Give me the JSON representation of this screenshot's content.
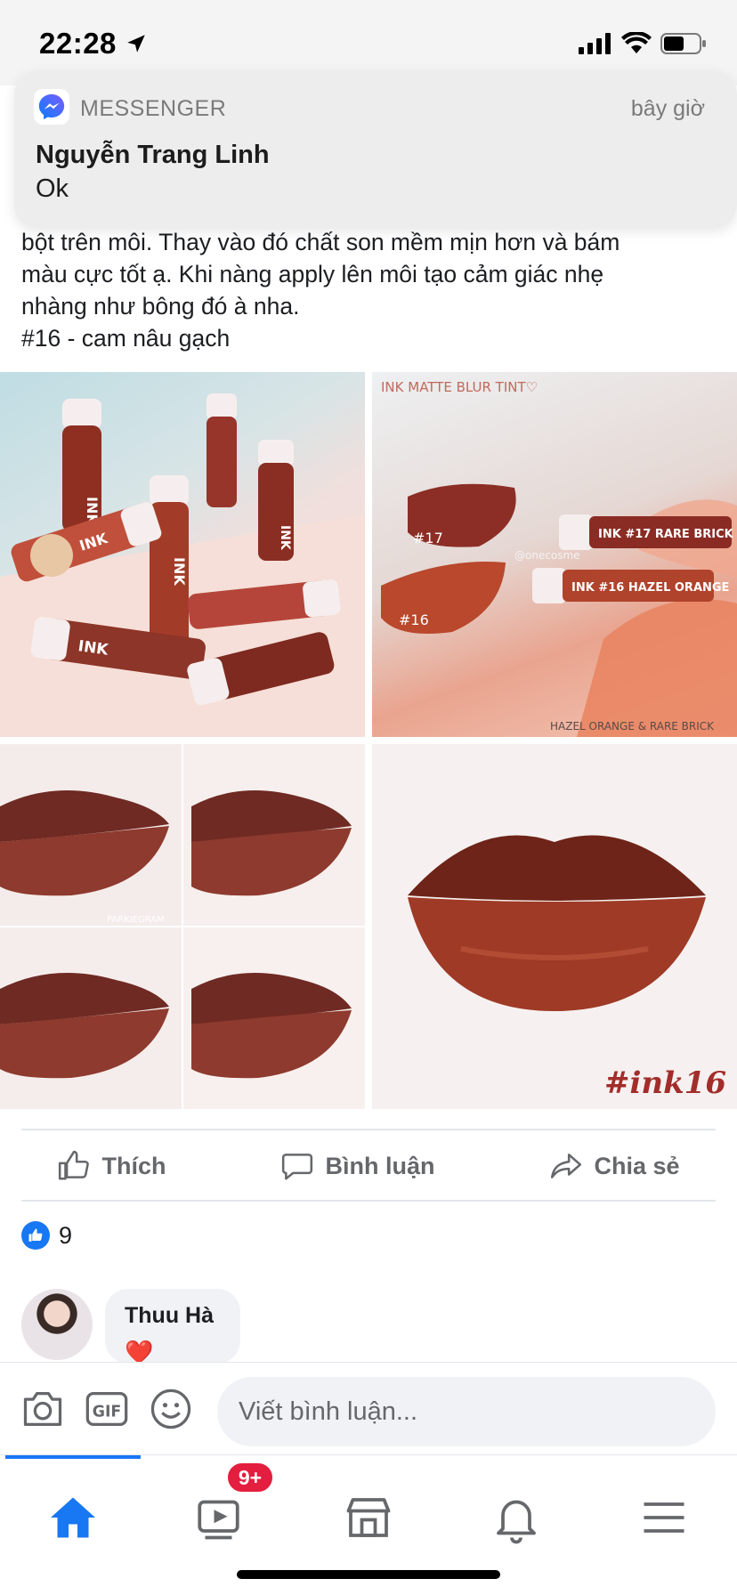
{
  "status_bar": {
    "time": "22:28"
  },
  "notification": {
    "app_name": "MESSENGER",
    "time": "bây giờ",
    "sender": "Nguyễn Trang Linh",
    "message": "Ok"
  },
  "post": {
    "text_lines": [
      "bột trên môi. Thay vào đó chất son mềm mịn hơn và bám",
      "màu cực tốt ạ. Khi nàng apply lên môi tạo cảm giác nhẹ",
      "nhàng như bông đó à nha.",
      "#16 - cam nâu gạch"
    ],
    "photos": {
      "p1": {
        "labels": [
          "INK",
          "INK",
          "INK",
          "INK",
          "INK"
        ]
      },
      "p2": {
        "title": "INK MATTE BLUR TINT♡",
        "swatch_a": "#17",
        "swatch_b": "#16",
        "tube_a": "INK #17 RARE BRICK",
        "tube_b": "INK #16 HAZEL ORANGE",
        "watermark": "@onecosme",
        "caption": "HAZEL ORANGE & RARE BRICK"
      },
      "p3": {
        "watermark": "PARKIEGRAM"
      },
      "p4": {
        "tag": "#ink16"
      }
    }
  },
  "actions": {
    "like": "Thích",
    "comment": "Bình luận",
    "share": "Chia sẻ"
  },
  "reactions": {
    "count": "9"
  },
  "comment": {
    "author": "Thuu Hà",
    "emoji": "❤️"
  },
  "composer": {
    "placeholder": "Viết bình luận..."
  },
  "tabbar": {
    "badge": "9+"
  },
  "colors": {
    "accent": "#1877f2",
    "badge": "#e41e3f",
    "lipstick": "#8e2f22"
  }
}
